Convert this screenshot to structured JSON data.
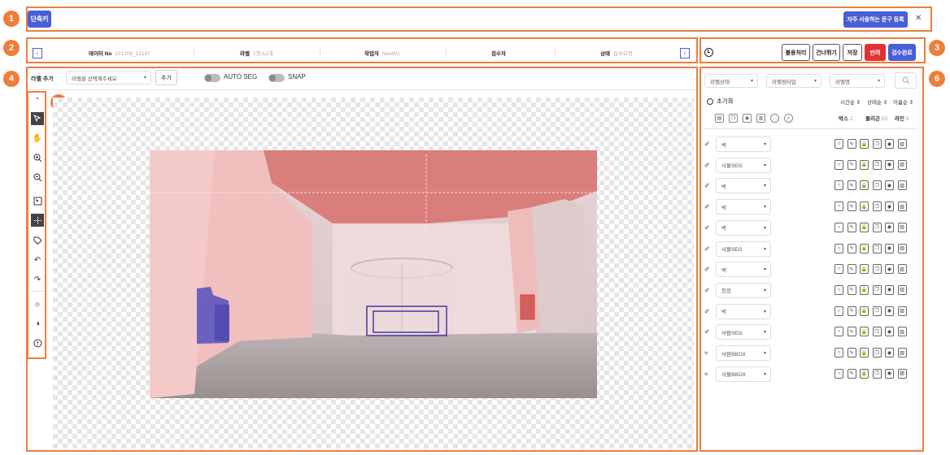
{
  "annotations": [
    "1",
    "2",
    "3",
    "4",
    "5",
    "6"
  ],
  "topbar": {
    "shortcut_label": "단축키",
    "phrase_button": "자주 사용하는 문구 등록",
    "close_icon": "✕"
  },
  "nav": {
    "prev_icon": "‹",
    "next_icon": "›",
    "items": [
      {
        "label": "데이터 No",
        "value": "221206_12187"
      },
      {
        "label": "라벨",
        "value": "2종/12개"
      },
      {
        "label": "작업자",
        "value": "NeoW1"
      },
      {
        "label": "검수자",
        "value": ""
      },
      {
        "label": "상태",
        "value": "검수요청"
      }
    ]
  },
  "actions": {
    "history_icon": "history-icon",
    "batch": "불용처리",
    "skip": "건너뛰기",
    "save": "저장",
    "reject": "반려",
    "approve": "검수완료"
  },
  "labelbar": {
    "add_label": "라벨 추가",
    "select_placeholder": "라벨을 선택해주세요",
    "add_button": "추가",
    "autoseg": "AUTO SEG",
    "snap": "SNAP"
  },
  "tools": [
    "chevron-up-icon",
    "select-icon",
    "hand-icon",
    "zoom-in-icon",
    "zoom-out-icon",
    "bbox-icon",
    "point-icon",
    "tag-icon",
    "undo-icon",
    "redo-icon",
    "brightness-icon",
    "contrast-icon",
    "info-icon"
  ],
  "panel": {
    "filters": [
      "라벨상태",
      "라벨링타입",
      "라벨명"
    ],
    "reset": "초기화",
    "sorts": [
      "시간순",
      "상태순",
      "이름순"
    ],
    "counts": [
      {
        "label": "박스",
        "value": "2"
      },
      {
        "label": "폴리곤",
        "value": "10"
      },
      {
        "label": "라인",
        "value": "0"
      }
    ],
    "rows": [
      {
        "type": "polygon",
        "name": "벽"
      },
      {
        "type": "polygon",
        "name": "사물SEG"
      },
      {
        "type": "polygon",
        "name": "벽"
      },
      {
        "type": "polygon",
        "name": "벽"
      },
      {
        "type": "polygon",
        "name": "벽"
      },
      {
        "type": "polygon",
        "name": "사물SEG"
      },
      {
        "type": "polygon",
        "name": "벽"
      },
      {
        "type": "polygon",
        "name": "천장"
      },
      {
        "type": "polygon",
        "name": "벽"
      },
      {
        "type": "polygon",
        "name": "사람SEG"
      },
      {
        "type": "bbox",
        "name": "사람BBOX"
      },
      {
        "type": "bbox",
        "name": "사물BBOX"
      }
    ]
  },
  "colors": {
    "accent": "#4a5ed6",
    "annotation": "#ef7d3c",
    "reject": "#e53030",
    "overlay": "#e88080"
  }
}
